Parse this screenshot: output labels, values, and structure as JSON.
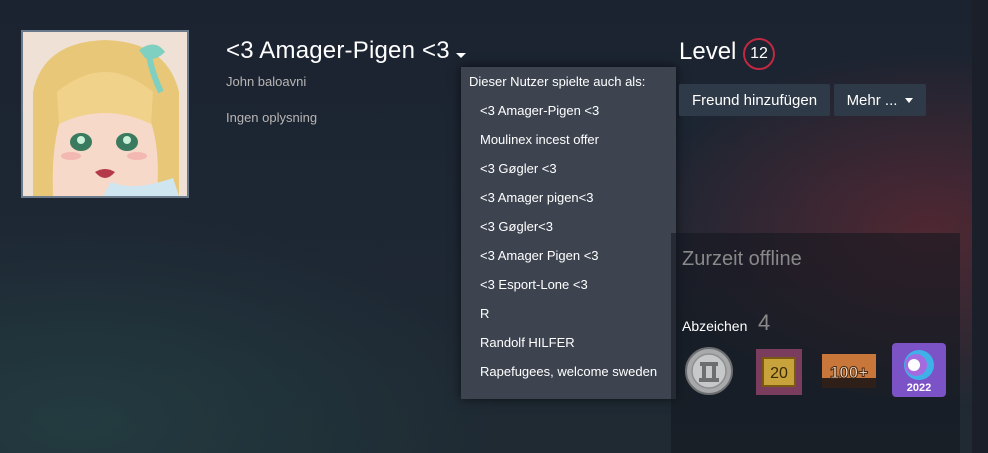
{
  "profile": {
    "persona_name": "<3 Amager-Pigen <3",
    "real_name": "John baloavni",
    "summary": "Ingen oplysning"
  },
  "alias_dropdown": {
    "title": "Dieser Nutzer spielte auch als:",
    "items": [
      "<3 Amager-Pigen <3",
      "Moulinex incest offer",
      "<3 Gøgler <3",
      "<3 Amager pigen<3",
      "<3 Gøgler<3",
      "<3 Amager Pigen <3",
      "<3 Esport-Lone <3",
      "R",
      "Randolf HILFER",
      "Rapefugees, welcome sweden"
    ]
  },
  "level": {
    "label": "Level",
    "value": "12"
  },
  "actions": {
    "add_friend": "Freund hinzufügen",
    "more": "Mehr ..."
  },
  "status_panel": {
    "status": "Zurzeit offline",
    "badges_label": "Abzeichen",
    "badges_count": "4",
    "badges": [
      {
        "name": "pillar-badge-icon"
      },
      {
        "name": "years-badge-icon",
        "text": "20"
      },
      {
        "name": "games-100-badge-icon",
        "text": "100+"
      },
      {
        "name": "steam-2022-badge-icon",
        "text": "2022"
      }
    ]
  },
  "colors": {
    "level_ring": "#c02942",
    "dropdown_bg": "#3d4450",
    "button_bg": "#2f3a48"
  }
}
